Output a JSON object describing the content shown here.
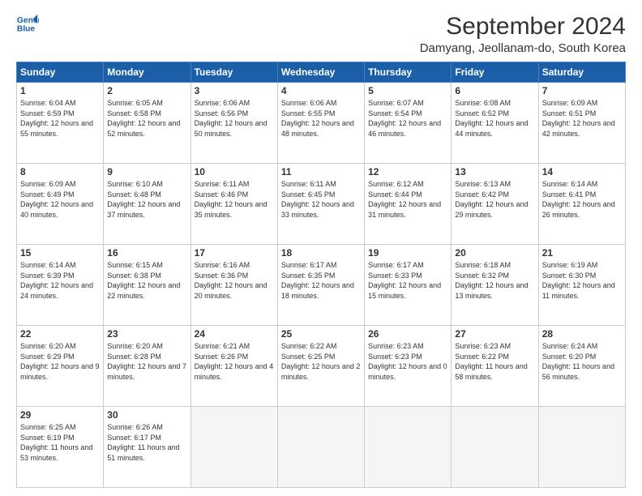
{
  "header": {
    "logo_line1": "General",
    "logo_line2": "Blue",
    "title": "September 2024",
    "subtitle": "Damyang, Jeollanam-do, South Korea"
  },
  "calendar": {
    "days_of_week": [
      "Sunday",
      "Monday",
      "Tuesday",
      "Wednesday",
      "Thursday",
      "Friday",
      "Saturday"
    ],
    "weeks": [
      [
        {
          "day": "1",
          "sunrise": "6:04 AM",
          "sunset": "6:59 PM",
          "daylight": "12 hours and 55 minutes."
        },
        {
          "day": "2",
          "sunrise": "6:05 AM",
          "sunset": "6:58 PM",
          "daylight": "12 hours and 52 minutes."
        },
        {
          "day": "3",
          "sunrise": "6:06 AM",
          "sunset": "6:56 PM",
          "daylight": "12 hours and 50 minutes."
        },
        {
          "day": "4",
          "sunrise": "6:06 AM",
          "sunset": "6:55 PM",
          "daylight": "12 hours and 48 minutes."
        },
        {
          "day": "5",
          "sunrise": "6:07 AM",
          "sunset": "6:54 PM",
          "daylight": "12 hours and 46 minutes."
        },
        {
          "day": "6",
          "sunrise": "6:08 AM",
          "sunset": "6:52 PM",
          "daylight": "12 hours and 44 minutes."
        },
        {
          "day": "7",
          "sunrise": "6:09 AM",
          "sunset": "6:51 PM",
          "daylight": "12 hours and 42 minutes."
        }
      ],
      [
        {
          "day": "8",
          "sunrise": "6:09 AM",
          "sunset": "6:49 PM",
          "daylight": "12 hours and 40 minutes."
        },
        {
          "day": "9",
          "sunrise": "6:10 AM",
          "sunset": "6:48 PM",
          "daylight": "12 hours and 37 minutes."
        },
        {
          "day": "10",
          "sunrise": "6:11 AM",
          "sunset": "6:46 PM",
          "daylight": "12 hours and 35 minutes."
        },
        {
          "day": "11",
          "sunrise": "6:11 AM",
          "sunset": "6:45 PM",
          "daylight": "12 hours and 33 minutes."
        },
        {
          "day": "12",
          "sunrise": "6:12 AM",
          "sunset": "6:44 PM",
          "daylight": "12 hours and 31 minutes."
        },
        {
          "day": "13",
          "sunrise": "6:13 AM",
          "sunset": "6:42 PM",
          "daylight": "12 hours and 29 minutes."
        },
        {
          "day": "14",
          "sunrise": "6:14 AM",
          "sunset": "6:41 PM",
          "daylight": "12 hours and 26 minutes."
        }
      ],
      [
        {
          "day": "15",
          "sunrise": "6:14 AM",
          "sunset": "6:39 PM",
          "daylight": "12 hours and 24 minutes."
        },
        {
          "day": "16",
          "sunrise": "6:15 AM",
          "sunset": "6:38 PM",
          "daylight": "12 hours and 22 minutes."
        },
        {
          "day": "17",
          "sunrise": "6:16 AM",
          "sunset": "6:36 PM",
          "daylight": "12 hours and 20 minutes."
        },
        {
          "day": "18",
          "sunrise": "6:17 AM",
          "sunset": "6:35 PM",
          "daylight": "12 hours and 18 minutes."
        },
        {
          "day": "19",
          "sunrise": "6:17 AM",
          "sunset": "6:33 PM",
          "daylight": "12 hours and 15 minutes."
        },
        {
          "day": "20",
          "sunrise": "6:18 AM",
          "sunset": "6:32 PM",
          "daylight": "12 hours and 13 minutes."
        },
        {
          "day": "21",
          "sunrise": "6:19 AM",
          "sunset": "6:30 PM",
          "daylight": "12 hours and 11 minutes."
        }
      ],
      [
        {
          "day": "22",
          "sunrise": "6:20 AM",
          "sunset": "6:29 PM",
          "daylight": "12 hours and 9 minutes."
        },
        {
          "day": "23",
          "sunrise": "6:20 AM",
          "sunset": "6:28 PM",
          "daylight": "12 hours and 7 minutes."
        },
        {
          "day": "24",
          "sunrise": "6:21 AM",
          "sunset": "6:26 PM",
          "daylight": "12 hours and 4 minutes."
        },
        {
          "day": "25",
          "sunrise": "6:22 AM",
          "sunset": "6:25 PM",
          "daylight": "12 hours and 2 minutes."
        },
        {
          "day": "26",
          "sunrise": "6:23 AM",
          "sunset": "6:23 PM",
          "daylight": "12 hours and 0 minutes."
        },
        {
          "day": "27",
          "sunrise": "6:23 AM",
          "sunset": "6:22 PM",
          "daylight": "11 hours and 58 minutes."
        },
        {
          "day": "28",
          "sunrise": "6:24 AM",
          "sunset": "6:20 PM",
          "daylight": "11 hours and 56 minutes."
        }
      ],
      [
        {
          "day": "29",
          "sunrise": "6:25 AM",
          "sunset": "6:19 PM",
          "daylight": "11 hours and 53 minutes."
        },
        {
          "day": "30",
          "sunrise": "6:26 AM",
          "sunset": "6:17 PM",
          "daylight": "11 hours and 51 minutes."
        },
        null,
        null,
        null,
        null,
        null
      ]
    ]
  }
}
